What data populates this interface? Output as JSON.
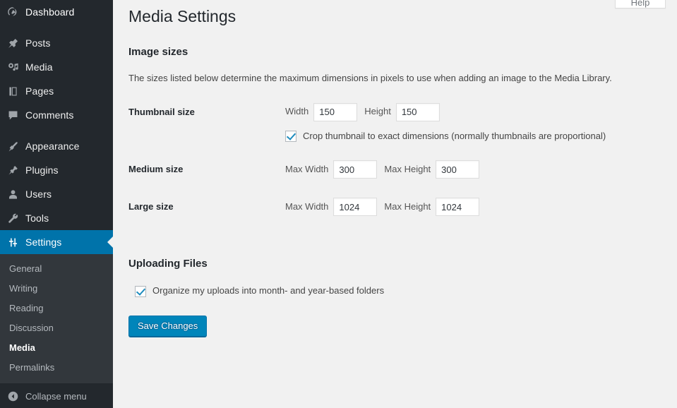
{
  "sidebar": {
    "items": [
      {
        "label": "Dashboard",
        "icon": "dashboard-icon",
        "current": false
      },
      {
        "label": "Posts",
        "icon": "pin-icon",
        "current": false
      },
      {
        "label": "Media",
        "icon": "media-icon",
        "current": false
      },
      {
        "label": "Pages",
        "icon": "pages-icon",
        "current": false
      },
      {
        "label": "Comments",
        "icon": "comments-icon",
        "current": false
      },
      {
        "label": "Appearance",
        "icon": "appearance-brush-icon",
        "current": false
      },
      {
        "label": "Plugins",
        "icon": "plugin-icon",
        "current": false
      },
      {
        "label": "Users",
        "icon": "user-icon",
        "current": false
      },
      {
        "label": "Tools",
        "icon": "wrench-icon",
        "current": false
      },
      {
        "label": "Settings",
        "icon": "settings-sliders-icon",
        "current": true
      }
    ],
    "submenu": [
      {
        "label": "General",
        "current": false
      },
      {
        "label": "Writing",
        "current": false
      },
      {
        "label": "Reading",
        "current": false
      },
      {
        "label": "Discussion",
        "current": false
      },
      {
        "label": "Media",
        "current": true
      },
      {
        "label": "Permalinks",
        "current": false
      }
    ],
    "collapse": {
      "label": "Collapse menu",
      "icon": "collapse-left-arrow-icon"
    },
    "colors": {
      "background": "#23282d",
      "submenu_background": "#32373c",
      "current_highlight": "#0073aa",
      "text": "#eeeeee"
    }
  },
  "help_tab": {
    "label": "Help"
  },
  "page": {
    "title": "Media Settings",
    "image_sizes": {
      "heading": "Image sizes",
      "description": "The sizes listed below determine the maximum dimensions in pixels to use when adding an image to the Media Library.",
      "rows": [
        {
          "label": "Thumbnail size",
          "width_label": "Width",
          "width_value": "150",
          "height_label": "Height",
          "height_value": "150",
          "crop": {
            "label": "Crop thumbnail to exact dimensions (normally thumbnails are proportional)",
            "checked": true
          }
        },
        {
          "label": "Medium size",
          "width_label": "Max Width",
          "width_value": "300",
          "height_label": "Max Height",
          "height_value": "300"
        },
        {
          "label": "Large size",
          "width_label": "Max Width",
          "width_value": "1024",
          "height_label": "Max Height",
          "height_value": "1024"
        }
      ]
    },
    "uploading_files": {
      "heading": "Uploading Files",
      "organize": {
        "label": "Organize my uploads into month- and year-based folders",
        "checked": true
      }
    },
    "submit": {
      "label": "Save Changes",
      "color": "#0085ba"
    }
  }
}
